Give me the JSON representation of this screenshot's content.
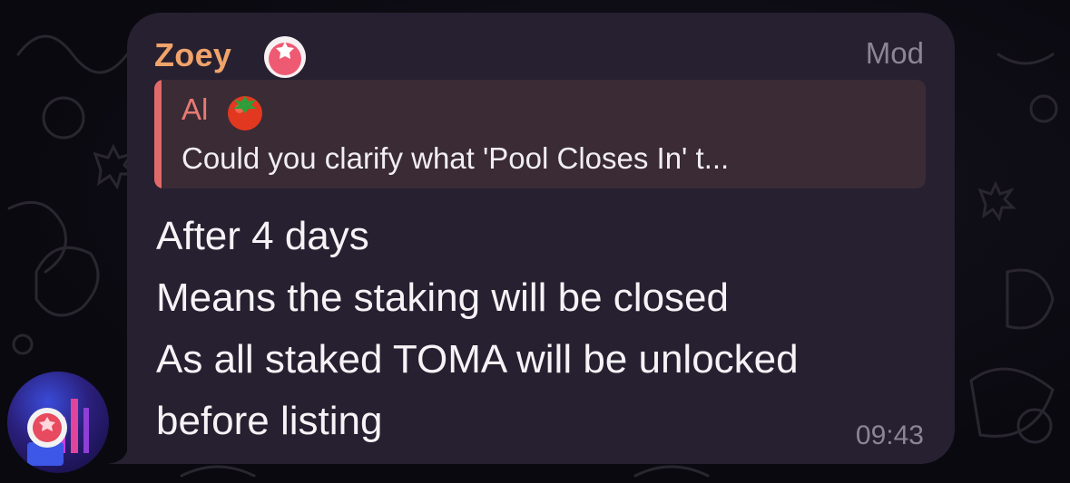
{
  "message": {
    "sender": "Zoey",
    "sender_badge_icon": "tomato-badge-icon",
    "role": "Mod",
    "reply": {
      "author": "Al",
      "author_emoji_icon": "tomato-icon",
      "text": "Could you clarify what 'Pool Closes In' t..."
    },
    "lines": [
      "After 4 days",
      "Means the staking will be closed",
      "As all staked TOMA will be unlocked",
      "before listing"
    ],
    "time": "09:43"
  },
  "colors": {
    "background": "#0b0a10",
    "bubble": "#272030",
    "sender": "#f0a36a",
    "reply_accent": "#e06a6a",
    "meta": "#8d8594"
  }
}
